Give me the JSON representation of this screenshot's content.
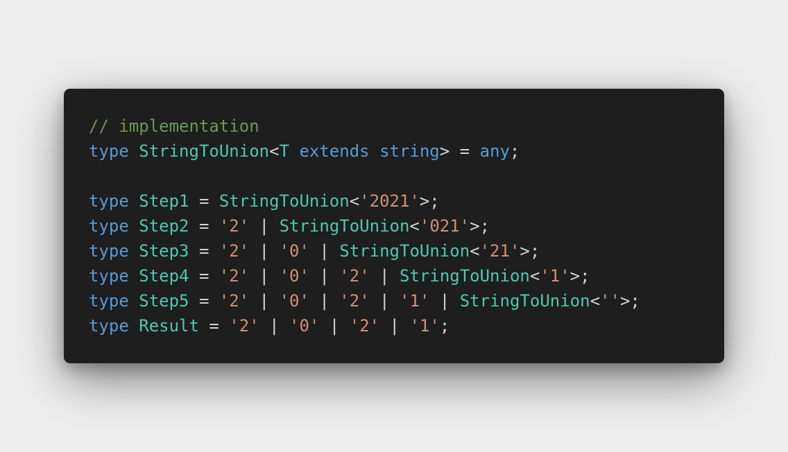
{
  "editor": {
    "lines": [
      {
        "tokens": [
          {
            "t": "comment",
            "v": "// implementation"
          }
        ]
      },
      {
        "tokens": [
          {
            "t": "kw",
            "v": "type"
          },
          {
            "t": "punc",
            "v": " "
          },
          {
            "t": "tp",
            "v": "StringToUnion"
          },
          {
            "t": "punc",
            "v": "<"
          },
          {
            "t": "tp",
            "v": "T"
          },
          {
            "t": "punc",
            "v": " "
          },
          {
            "t": "kw",
            "v": "extends"
          },
          {
            "t": "punc",
            "v": " "
          },
          {
            "t": "kw",
            "v": "string"
          },
          {
            "t": "punc",
            "v": "> = "
          },
          {
            "t": "kw",
            "v": "any"
          },
          {
            "t": "punc",
            "v": ";"
          }
        ]
      },
      {
        "tokens": []
      },
      {
        "tokens": [
          {
            "t": "kw",
            "v": "type"
          },
          {
            "t": "punc",
            "v": " "
          },
          {
            "t": "tp",
            "v": "Step1"
          },
          {
            "t": "punc",
            "v": " = "
          },
          {
            "t": "tp",
            "v": "StringToUnion"
          },
          {
            "t": "punc",
            "v": "<"
          },
          {
            "t": "str",
            "v": "'2021'"
          },
          {
            "t": "punc",
            "v": ">;"
          }
        ]
      },
      {
        "tokens": [
          {
            "t": "kw",
            "v": "type"
          },
          {
            "t": "punc",
            "v": " "
          },
          {
            "t": "tp",
            "v": "Step2"
          },
          {
            "t": "punc",
            "v": " = "
          },
          {
            "t": "str",
            "v": "'2'"
          },
          {
            "t": "punc",
            "v": " | "
          },
          {
            "t": "tp",
            "v": "StringToUnion"
          },
          {
            "t": "punc",
            "v": "<"
          },
          {
            "t": "str",
            "v": "'021'"
          },
          {
            "t": "punc",
            "v": ">;"
          }
        ]
      },
      {
        "tokens": [
          {
            "t": "kw",
            "v": "type"
          },
          {
            "t": "punc",
            "v": " "
          },
          {
            "t": "tp",
            "v": "Step3"
          },
          {
            "t": "punc",
            "v": " = "
          },
          {
            "t": "str",
            "v": "'2'"
          },
          {
            "t": "punc",
            "v": " | "
          },
          {
            "t": "str",
            "v": "'0'"
          },
          {
            "t": "punc",
            "v": " | "
          },
          {
            "t": "tp",
            "v": "StringToUnion"
          },
          {
            "t": "punc",
            "v": "<"
          },
          {
            "t": "str",
            "v": "'21'"
          },
          {
            "t": "punc",
            "v": ">;"
          }
        ]
      },
      {
        "tokens": [
          {
            "t": "kw",
            "v": "type"
          },
          {
            "t": "punc",
            "v": " "
          },
          {
            "t": "tp",
            "v": "Step4"
          },
          {
            "t": "punc",
            "v": " = "
          },
          {
            "t": "str",
            "v": "'2'"
          },
          {
            "t": "punc",
            "v": " | "
          },
          {
            "t": "str",
            "v": "'0'"
          },
          {
            "t": "punc",
            "v": " | "
          },
          {
            "t": "str",
            "v": "'2'"
          },
          {
            "t": "punc",
            "v": " | "
          },
          {
            "t": "tp",
            "v": "StringToUnion"
          },
          {
            "t": "punc",
            "v": "<"
          },
          {
            "t": "str",
            "v": "'1'"
          },
          {
            "t": "punc",
            "v": ">;"
          }
        ]
      },
      {
        "tokens": [
          {
            "t": "kw",
            "v": "type"
          },
          {
            "t": "punc",
            "v": " "
          },
          {
            "t": "tp",
            "v": "Step5"
          },
          {
            "t": "punc",
            "v": " = "
          },
          {
            "t": "str",
            "v": "'2'"
          },
          {
            "t": "punc",
            "v": " | "
          },
          {
            "t": "str",
            "v": "'0'"
          },
          {
            "t": "punc",
            "v": " | "
          },
          {
            "t": "str",
            "v": "'2'"
          },
          {
            "t": "punc",
            "v": " | "
          },
          {
            "t": "str",
            "v": "'1'"
          },
          {
            "t": "punc",
            "v": " | "
          },
          {
            "t": "tp",
            "v": "StringToUnion"
          },
          {
            "t": "punc",
            "v": "<"
          },
          {
            "t": "str",
            "v": "''"
          },
          {
            "t": "punc",
            "v": ">;"
          }
        ]
      },
      {
        "tokens": [
          {
            "t": "kw",
            "v": "type"
          },
          {
            "t": "punc",
            "v": " "
          },
          {
            "t": "tp",
            "v": "Result"
          },
          {
            "t": "punc",
            "v": " = "
          },
          {
            "t": "str",
            "v": "'2'"
          },
          {
            "t": "punc",
            "v": " | "
          },
          {
            "t": "str",
            "v": "'0'"
          },
          {
            "t": "punc",
            "v": " | "
          },
          {
            "t": "str",
            "v": "'2'"
          },
          {
            "t": "punc",
            "v": " | "
          },
          {
            "t": "str",
            "v": "'1'"
          },
          {
            "t": "punc",
            "v": ";"
          }
        ]
      }
    ]
  },
  "colors": {
    "background": "#eeeeee",
    "editor_background": "#1e1e1e",
    "comment": "#6a9955",
    "keyword": "#569cd6",
    "type_name": "#4ec9b0",
    "string": "#ce9178",
    "punctuation": "#d4d4d4"
  }
}
